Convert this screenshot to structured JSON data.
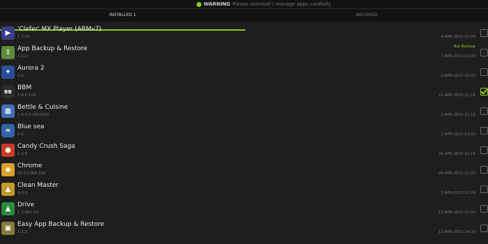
{
  "warning": {
    "label": "WARNING",
    "text": "Please uninstall / manage apps carefully"
  },
  "tabs": [
    {
      "label": "INSTALLED 1"
    },
    {
      "label": "ARCHIVED"
    }
  ],
  "apps": [
    {
      "name": "'Clefer' MX Player (ARMv7)",
      "sub": "1.7.19",
      "date": "4-APR-2013 11:06",
      "status": "",
      "checked": false,
      "icon": "play-icon",
      "icon_color": "#3a3f8c",
      "glyph": "▶"
    },
    {
      "name": "App Backup & Restore",
      "sub": "1.0.2",
      "date": "7-APR-2013 13:00",
      "status": "Not Backup",
      "checked": false,
      "icon": "backup-icon",
      "icon_color": "#5a8a3a",
      "glyph": "⇧"
    },
    {
      "name": "Aurora 2",
      "sub": "1.0",
      "date": "2-APR-2013 10:20",
      "status": "",
      "checked": false,
      "icon": "aurora-icon",
      "icon_color": "#2a4f9a",
      "glyph": "✦"
    },
    {
      "name": "BBM",
      "sub": "1.0.0.129",
      "date": "22-APR-2013 11:16",
      "status": "",
      "checked": true,
      "icon": "bbm-icon",
      "icon_color": "#2b2b2b",
      "glyph": "BB"
    },
    {
      "name": "Bettle & Cuisine",
      "sub": "1.0.0.1-2013016",
      "date": "1-APR-2013 11:16",
      "status": "",
      "checked": false,
      "icon": "calculator-icon",
      "icon_color": "#3f6fb5",
      "glyph": "▦"
    },
    {
      "name": "Blue sea",
      "sub": "1.0",
      "date": "7-APR-2013 13:20",
      "status": "",
      "checked": false,
      "icon": "sea-icon",
      "icon_color": "#2f64a8",
      "glyph": "≈"
    },
    {
      "name": "Candy Crush Saga",
      "sub": "1.0.0",
      "date": "26-APR-2013 11:16",
      "status": "",
      "checked": false,
      "icon": "candy-icon",
      "icon_color": "#c43b2a",
      "glyph": "●"
    },
    {
      "name": "Chrome",
      "sub": "25.0.1364.169",
      "date": "26-APR-2013 11:20",
      "status": "",
      "checked": false,
      "icon": "chrome-icon",
      "icon_color": "#d8a02a",
      "glyph": "◉"
    },
    {
      "name": "Clean Master",
      "sub": "4.0.0",
      "date": "1-APR-2013 11:16",
      "status": "",
      "checked": false,
      "icon": "broom-icon",
      "icon_color": "#c29a2a",
      "glyph": "▲"
    },
    {
      "name": "Drive",
      "sub": "1.1.491.12",
      "date": "11-APR-2013 11:20",
      "status": "",
      "checked": false,
      "icon": "drive-icon",
      "icon_color": "#2d8a3f",
      "glyph": "▲"
    },
    {
      "name": "Easy App Backup & Restore",
      "sub": "1.2.3",
      "date": "13-APR-2013 14:30",
      "status": "",
      "checked": false,
      "icon": "easy-backup-icon",
      "icon_color": "#8a7a3a",
      "glyph": "▣"
    }
  ]
}
